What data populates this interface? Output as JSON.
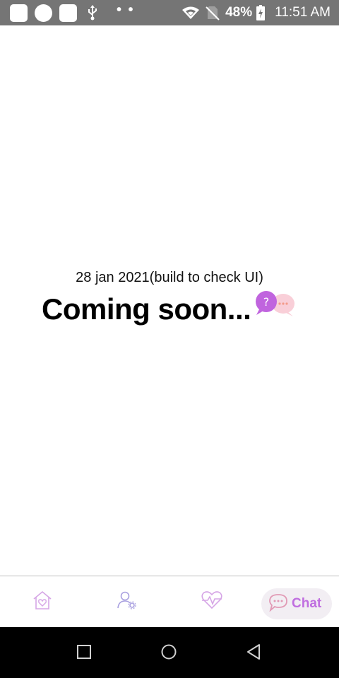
{
  "status_bar": {
    "battery_percent": "48%",
    "time": "11:51 AM",
    "dots": "• •",
    "icons": [
      "app-icon",
      "app-icon-round",
      "app-icon",
      "usb-icon",
      "wifi-icon",
      "no-sim-icon",
      "battery-charging-icon"
    ]
  },
  "main": {
    "build_note": "28 jan 2021(build to check UI)",
    "coming_soon": "Coming soon...",
    "illustration_icon": "chat-bubbles-icon"
  },
  "bottom_nav": {
    "items": [
      {
        "icon": "home-heart-icon"
      },
      {
        "icon": "user-settings-icon"
      },
      {
        "icon": "heart-pulse-icon"
      },
      {
        "icon": "chat-icon",
        "label": "Chat",
        "active": true
      }
    ]
  },
  "system_nav": {
    "buttons": [
      "recents-icon",
      "home-icon",
      "back-icon"
    ]
  },
  "colors": {
    "status_bar_bg": "#757575",
    "accent": "#c06ee0",
    "nav_icon": "#d6a6e6",
    "active_pill_bg": "#f2eef3",
    "system_nav_bg": "#000000"
  }
}
